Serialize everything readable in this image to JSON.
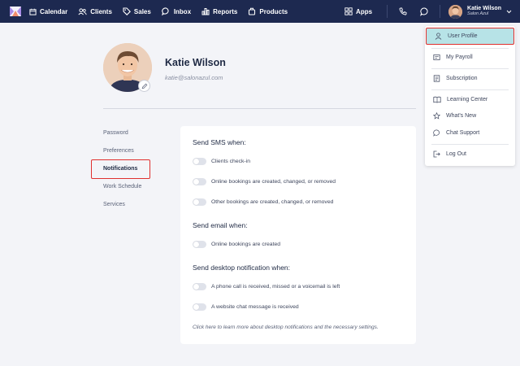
{
  "nav": {
    "items": [
      {
        "label": "Calendar",
        "icon": "calendar-icon"
      },
      {
        "label": "Clients",
        "icon": "clients-icon"
      },
      {
        "label": "Sales",
        "icon": "tag-icon"
      },
      {
        "label": "Inbox",
        "icon": "inbox-icon"
      },
      {
        "label": "Reports",
        "icon": "bar-chart-icon"
      },
      {
        "label": "Products",
        "icon": "products-icon"
      }
    ],
    "apps_label": "Apps",
    "user_name": "Katie Wilson",
    "salon_name": "Salon Azul"
  },
  "profile": {
    "name": "Katie Wilson",
    "email": "katie@salonazul.com"
  },
  "side_menu": {
    "items": [
      "Password",
      "Preferences",
      "Notifications",
      "Work Schedule",
      "Services"
    ],
    "active": "Notifications"
  },
  "notifications": {
    "sms_title": "Send SMS when:",
    "sms_items": [
      "Clients check-in",
      "Online bookings are created, changed, or removed",
      "Other bookings are created, changed, or removed"
    ],
    "email_title": "Send email when:",
    "email_items": [
      "Online bookings are created"
    ],
    "desktop_title": "Send desktop notification when:",
    "desktop_items": [
      "A phone call is received, missed or a voicemail is left",
      "A website chat message is received"
    ],
    "help_text": "Click here to learn more about desktop notifications and the necessary settings."
  },
  "user_menu": {
    "items": [
      {
        "label": "User Profile",
        "icon": "user-icon"
      },
      {
        "label": "My Payroll",
        "icon": "payroll-icon"
      },
      {
        "label": "Subscription",
        "icon": "subscription-icon"
      },
      {
        "label": "Learning Center",
        "icon": "book-icon"
      },
      {
        "label": "What's New",
        "icon": "star-icon"
      },
      {
        "label": "Chat Support",
        "icon": "chat-icon"
      },
      {
        "label": "Log Out",
        "icon": "logout-icon"
      }
    ],
    "selected": "User Profile"
  },
  "colors": {
    "nav_bg": "#1d2950",
    "page_bg": "#f3f4f8",
    "highlight_border": "#e0302f",
    "selected_bg": "#b7e3e7"
  }
}
